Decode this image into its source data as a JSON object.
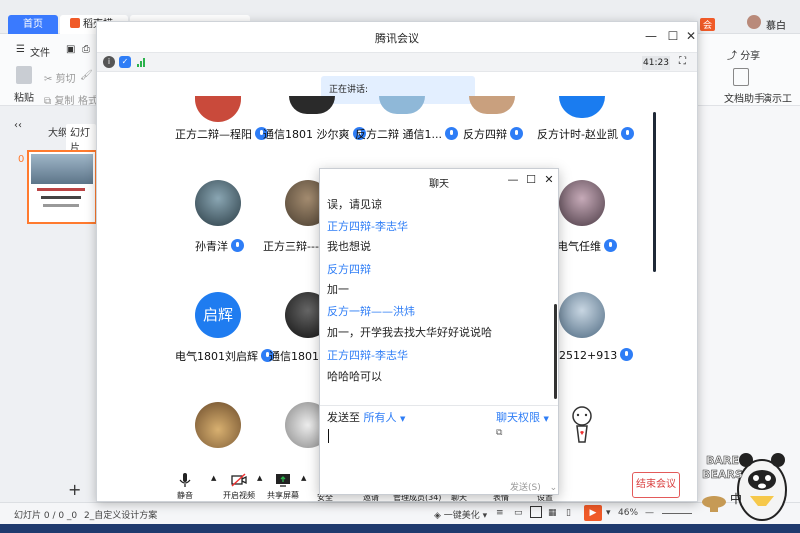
{
  "wps": {
    "tabs": [
      "首页",
      "稻壳模"
    ],
    "user": "慕白",
    "share": "分享",
    "toolbar": {
      "file": "文件",
      "paste": "粘贴",
      "cut": "剪切",
      "copy": "复制",
      "format": "格式",
      "doc_helper": "文档助手",
      "present": "演示工"
    },
    "panel_tabs": [
      "大纲",
      "幻灯片"
    ],
    "slide_index": "0",
    "status": {
      "slide_count": "幻灯片 0 / 0 _0",
      "template": "2_自定义设计方案",
      "beautify": "一键美化",
      "zoom": "46%"
    }
  },
  "meeting": {
    "title": "腾讯会议",
    "timer": "41:23",
    "speaking_label": "正在讲话:",
    "participants": [
      {
        "name": "正方二辩—程阳",
        "avatar_color": "#c94a3b"
      },
      {
        "name": "通信1801 沙尔爽",
        "avatar_color": "#2a2a2a"
      },
      {
        "name": "反方二辩 通信1...",
        "avatar_color": "#8fb8d8"
      },
      {
        "name": "反方四辩",
        "avatar_color": "#c9a07e"
      },
      {
        "name": "反方计时-赵业凯",
        "avatar_color": "#1a7cf0"
      },
      {
        "name": "孙青洋",
        "avatar_color": "#3b5a6a"
      },
      {
        "name": "正方三辩---童",
        "avatar_color": "#7a6a55"
      },
      {
        "name": "电气任维",
        "avatar_color": "#6d5a66"
      },
      {
        "name": "电气1801刘启辉",
        "avatar_text": "启辉",
        "avatar_color": "#1f7cf0"
      },
      {
        "name": "通信1801张",
        "avatar_color": "#333333"
      },
      {
        "name": "2512+913",
        "avatar_color": "#7ea2bd"
      },
      {
        "name": "",
        "avatar_color": "#9a7a5a"
      },
      {
        "name": "",
        "avatar_color": "#cfcfcf"
      }
    ],
    "toolbar": {
      "mute": "静音",
      "video": "开启视频",
      "share": "共享屏幕",
      "security": "安全",
      "invite": "邀请",
      "members": "管理成员(34)",
      "chat": "聊天",
      "reaction": "表情",
      "settings": "设置",
      "end": "结束会议"
    }
  },
  "chat": {
    "title": "聊天",
    "messages": [
      {
        "text": "误，请见谅"
      },
      {
        "sender": "正方四辩-李志华"
      },
      {
        "text": "我也想说"
      },
      {
        "sender": "反方四辩"
      },
      {
        "text": "加一"
      },
      {
        "sender": "反方一辩——洪炜"
      },
      {
        "text": "加一，开学我去找大华好好说说哈"
      },
      {
        "sender": "正方四辩-李志华"
      },
      {
        "text": "哈哈哈可以"
      }
    ],
    "send_to_label": "发送至",
    "send_to_value": "所有人",
    "permission": "聊天权限",
    "send_button": "发送(S)"
  },
  "sticker": {
    "text_top": "BARE",
    "text_bottom": "BEARS",
    "char": "中"
  }
}
